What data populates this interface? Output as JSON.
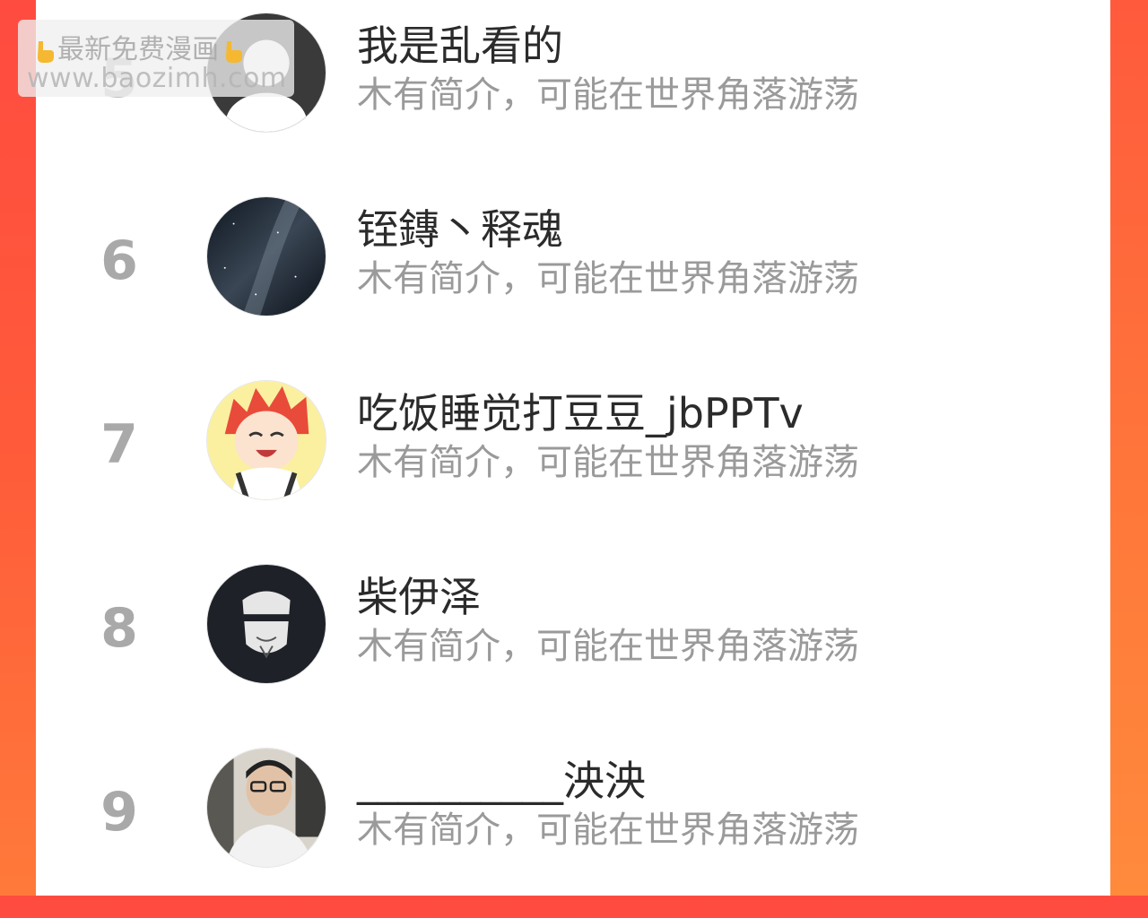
{
  "watermark": {
    "line1": "最新免费漫画",
    "line2": "www.baozimh.com"
  },
  "ranking": [
    {
      "rank": "5",
      "name": "我是乱看的",
      "bio": "木有简介，可能在世界角落游荡",
      "avatar": "default-user-avatar"
    },
    {
      "rank": "6",
      "name": "铚鏄丶释魂",
      "bio": "木有简介，可能在世界角落游荡",
      "avatar": "galaxy-avatar"
    },
    {
      "rank": "7",
      "name": "吃饭睡觉打豆豆_jbPPTv",
      "bio": "木有简介，可能在世界角落游荡",
      "avatar": "anime-boy-avatar"
    },
    {
      "rank": "8",
      "name": "柴伊泽",
      "bio": "木有简介，可能在世界角落游荡",
      "avatar": "masked-face-avatar"
    },
    {
      "rank": "9",
      "name": "__________泱泱",
      "bio": "木有简介，可能在世界角落游荡",
      "avatar": "photo-person-avatar"
    }
  ],
  "colors": {
    "background_red": "#ff4b40",
    "background_orange": "#ff7a3a",
    "rank_number": "#a9a9a9",
    "name_text": "#2b2b2b",
    "bio_text": "#9a9a9a"
  }
}
